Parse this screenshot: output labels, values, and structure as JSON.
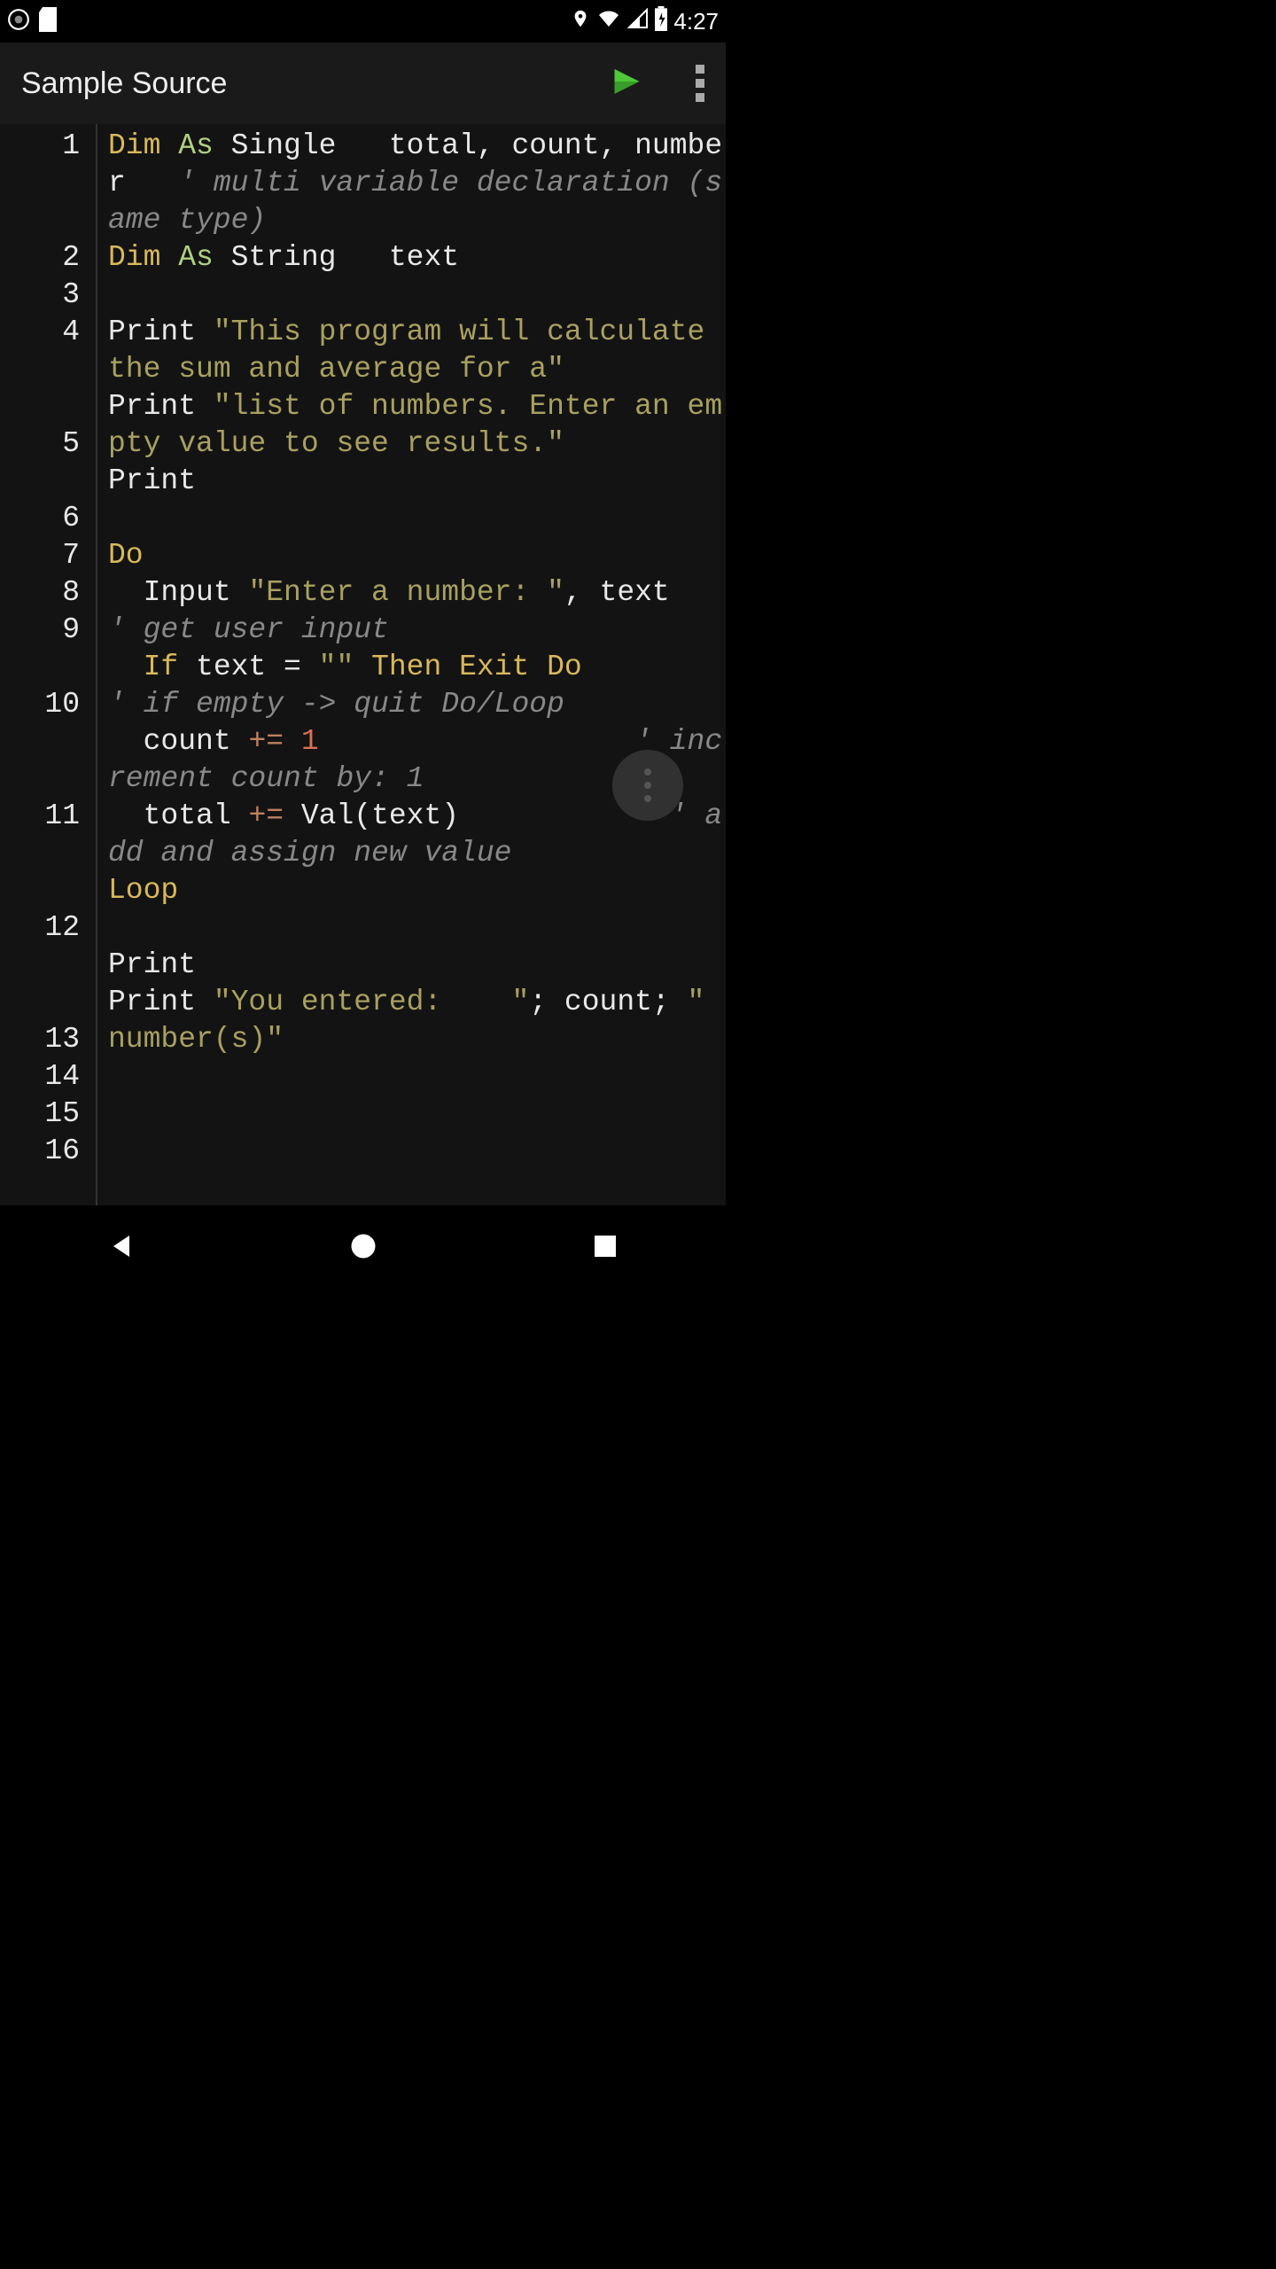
{
  "status": {
    "time": "4:27"
  },
  "appbar": {
    "title": "Sample Source"
  },
  "gutter": {
    "l1": "1",
    "l1b": " ",
    "l1c": " ",
    "l2": "2",
    "l3": "3",
    "l4": "4",
    "l4b": " ",
    "l4c": " ",
    "l5": "5",
    "l5b": " ",
    "l6": "6",
    "l7": "7",
    "l8": "8",
    "l9": "9",
    "l9b": " ",
    "l10": "10",
    "l10b": " ",
    "l10c": " ",
    "l11": "11",
    "l11b": " ",
    "l11c": " ",
    "l12": "12",
    "l12b": " ",
    "l12c": " ",
    "l13": "13",
    "l14": "14",
    "l15": "15",
    "l16": "16",
    "l16b": " "
  },
  "code": {
    "l1_dim": "Dim",
    "l1_as": "As",
    "l1_rest": " Single   total, count, number   ",
    "l1_cmt": "' multi variable declaration (same type)",
    "l2_dim": "Dim",
    "l2_as": "As",
    "l2_rest": " String   text",
    "l4_print": "Print ",
    "l4_str": "\"This program will calculate the sum and average for a\"",
    "l5_print": "Print ",
    "l5_str": "\"list of numbers. Enter an empty value to see results.\"",
    "l6_print": "Print",
    "l8_do": "Do",
    "l9_input": "  Input ",
    "l9_str": "\"Enter a number: \"",
    "l9_rest": ", text            ",
    "l9_cmt": "' get user input",
    "l10_if": "  If",
    "l10_mid": " text = ",
    "l10_str": "\"\"",
    "l10_then": " Then",
    "l10_exit": " Exit",
    "l10_do": " Do",
    "l10_sp": "              ",
    "l10_cmt": "' if empty -> quit Do/Loop",
    "l11_pre": "  count ",
    "l11_op": "+=",
    "l11_sp": " ",
    "l11_num": "1",
    "l11_sp2": "                  ",
    "l11_cmt": "' increment count by: 1",
    "l12_pre": "  total ",
    "l12_op": "+=",
    "l12_rest": " Val(text)            ",
    "l12_cmt": "' add and assign new value",
    "l13_loop": "Loop",
    "l15_print": "Print",
    "l16_print": "Print ",
    "l16_str1": "\"You entered:    \"",
    "l16_mid": "; count; ",
    "l16_str2": "\"  number(s)\""
  }
}
